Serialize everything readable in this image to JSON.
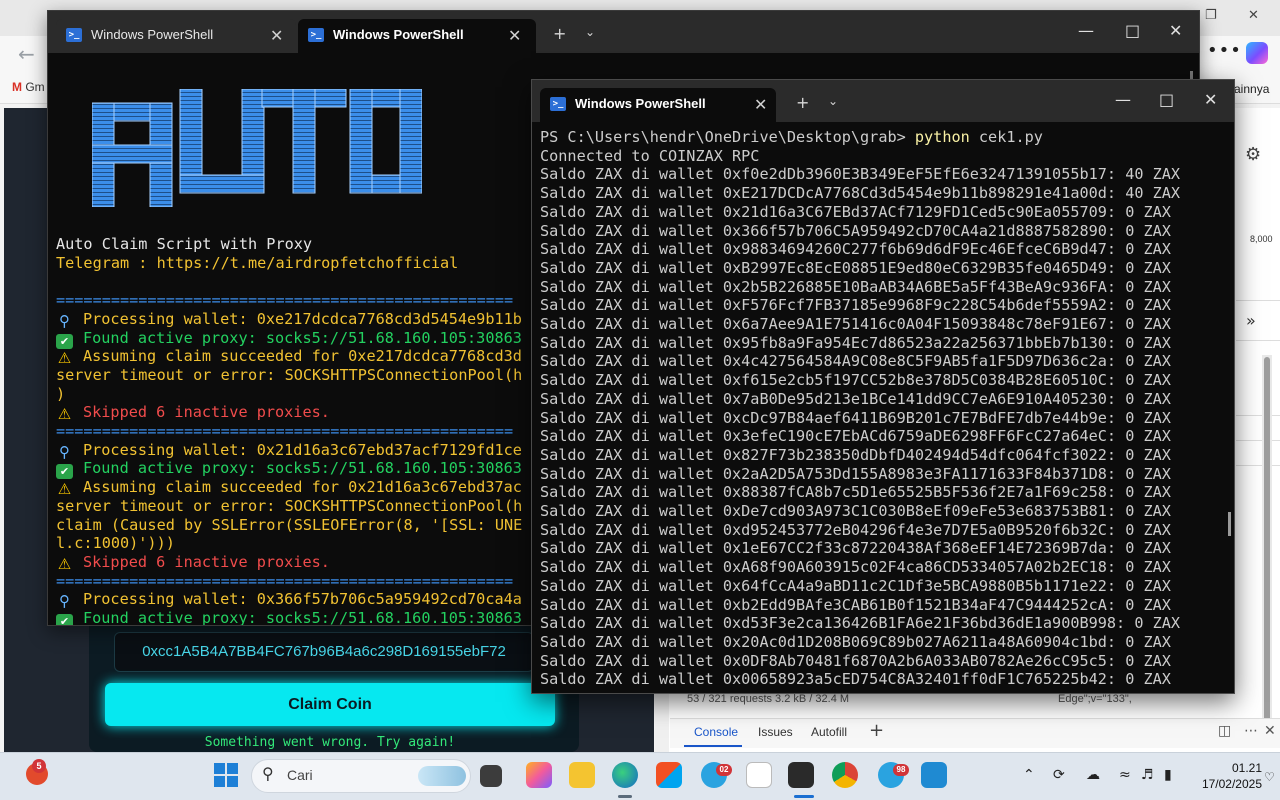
{
  "browser": {
    "bookmark_left": "Gm",
    "bookmark_right": "ainnya"
  },
  "dapp": {
    "wallet_address": "0xcc1A5B4A7BB4FC767b96B4a6c298D169155ebF72",
    "claim_button": "Claim Coin",
    "error_message": "Something went wrong. Try again!"
  },
  "devtools": {
    "status_left": "53 / 321 requests   3.2 kB / 32.4 M",
    "status_right": "Edge\";v=\"133\",",
    "tabs": [
      "Console",
      "Issues",
      "Autofill"
    ],
    "number_label": "8,000"
  },
  "window1": {
    "tabs": [
      {
        "label": "Windows PowerShell",
        "active": false
      },
      {
        "label": "Windows PowerShell",
        "active": true
      }
    ],
    "ascii_logo_text": "AUTO",
    "lines": [
      {
        "text": "Auto Claim Script with Proxy",
        "color": "white",
        "icon": ""
      },
      {
        "text": "Telegram : https://t.me/airdropfetchofficial",
        "color": "yellow",
        "icon": ""
      },
      {
        "text": "",
        "color": "white",
        "icon": ""
      },
      {
        "text": "==================================================",
        "color": "cyan",
        "icon": ""
      },
      {
        "text": "Processing wallet: 0xe217dcdca7768cd3d5454e9b11b",
        "color": "yellow",
        "icon": "magnifier"
      },
      {
        "text": "Found active proxy: socks5://51.68.160.105:30863",
        "color": "green",
        "icon": "check"
      },
      {
        "text": "Assuming claim succeeded for 0xe217dcdca7768cd3d",
        "color": "yellow",
        "icon": "warning"
      },
      {
        "text": "server timeout or error: SOCKSHTTPSConnectionPool(h",
        "color": "yellow",
        "icon": ""
      },
      {
        "text": ")",
        "color": "yellow",
        "icon": ""
      },
      {
        "text": "Skipped 6 inactive proxies.",
        "color": "red",
        "icon": "warning"
      },
      {
        "text": "==================================================",
        "color": "cyan",
        "icon": ""
      },
      {
        "text": "Processing wallet: 0x21d16a3c67ebd37acf7129fd1ce",
        "color": "yellow",
        "icon": "magnifier"
      },
      {
        "text": "Found active proxy: socks5://51.68.160.105:30863",
        "color": "green",
        "icon": "check"
      },
      {
        "text": "Assuming claim succeeded for 0x21d16a3c67ebd37ac",
        "color": "yellow",
        "icon": "warning"
      },
      {
        "text": "server timeout or error: SOCKSHTTPSConnectionPool(h",
        "color": "yellow",
        "icon": ""
      },
      {
        "text": "claim (Caused by SSLError(SSLEOFError(8, '[SSL: UNE",
        "color": "yellow",
        "icon": ""
      },
      {
        "text": "l.c:1000)')))",
        "color": "yellow",
        "icon": ""
      },
      {
        "text": "Skipped 6 inactive proxies.",
        "color": "red",
        "icon": "warning"
      },
      {
        "text": "==================================================",
        "color": "cyan",
        "icon": ""
      },
      {
        "text": "Processing wallet: 0x366f57b706c5a959492cd70ca4a",
        "color": "yellow",
        "icon": "magnifier"
      },
      {
        "text": "Found active proxy: socks5://51.68.160.105:30863",
        "color": "green",
        "icon": "check"
      }
    ]
  },
  "window2": {
    "tab_label": "Windows PowerShell",
    "prompt": "PS C:\\Users\\hendr\\OneDrive\\Desktop\\grab> ",
    "command": "python",
    "command_arg": " cek1.py",
    "lines": [
      "Connected to COINZAX RPC",
      "Saldo ZAX di wallet 0xf0e2dDb3960E3B349EeF5EfE6e32471391055b17: 40 ZAX",
      "Saldo ZAX di wallet 0xE217DCDcA7768Cd3d5454e9b11b898291e41a00d: 40 ZAX",
      "Saldo ZAX di wallet 0x21d16a3C67EBd37ACf7129FD1Ced5c90Ea055709: 0 ZAX",
      "Saldo ZAX di wallet 0x366f57b706C5A959492cD70CA4a21d8887582890: 0 ZAX",
      "Saldo ZAX di wallet 0x98834694260C277f6b69d6dF9Ec46EfceC6B9d47: 0 ZAX",
      "Saldo ZAX di wallet 0xB2997Ec8EcE08851E9ed80eC6329B35fe0465D49: 0 ZAX",
      "Saldo ZAX di wallet 0x2b5B226885E10BaAB34A6BE5a5Ff43BeA9c936FA: 0 ZAX",
      "Saldo ZAX di wallet 0xF576Fcf7FB37185e9968F9c228C54b6def5559A2: 0 ZAX",
      "Saldo ZAX di wallet 0x6a7Aee9A1E751416c0A04F15093848c78eF91E67: 0 ZAX",
      "Saldo ZAX di wallet 0x95fb8a9Fa954Ec7d86523a22a256371bbEb7b130: 0 ZAX",
      "Saldo ZAX di wallet 0x4c427564584A9C08e8C5F9AB5fa1F5D97D636c2a: 0 ZAX",
      "Saldo ZAX di wallet 0xf615e2cb5f197CC52b8e378D5C0384B28E60510C: 0 ZAX",
      "Saldo ZAX di wallet 0x7aB0De95d213e1BCe141dd9CC7eA6E910A405230: 0 ZAX",
      "Saldo ZAX di wallet 0xcDc97B84aef6411B69B201c7E7BdFE7db7e44b9e: 0 ZAX",
      "Saldo ZAX di wallet 0x3efeC190cE7EbACd6759aDE6298FF6FcC27a64eC: 0 ZAX",
      "Saldo ZAX di wallet 0x827F73b238350dDbfD402494d54dfc064fcf3022: 0 ZAX",
      "Saldo ZAX di wallet 0x2aA2D5A753Dd155A8983e3FA1171633F84b371D8: 0 ZAX",
      "Saldo ZAX di wallet 0x88387fCA8b7c5D1e65525B5F536f2E7a1F69c258: 0 ZAX",
      "Saldo ZAX di wallet 0xDe7cd903A973C1C030B8eEf09eFe53e683753B81: 0 ZAX",
      "Saldo ZAX di wallet 0xd952453772eB04296f4e3e7D7E5a0B9520f6b32C: 0 ZAX",
      "Saldo ZAX di wallet 0x1eE67CC2f33c87220438Af368eEF14E72369B7da: 0 ZAX",
      "Saldo ZAX di wallet 0xA68f90A603915c02F4ca86CD5334057A02b2EC18: 0 ZAX",
      "Saldo ZAX di wallet 0x64fCcA4a9aBD11c2C1Df3e5BCA9880B5b1171e22: 0 ZAX",
      "Saldo ZAX di wallet 0xb2Edd9BAfe3CAB61B0f1521B34aF47C9444252cA: 0 ZAX",
      "Saldo ZAX di wallet 0xd53F3e2ca136426B1FA6e21F36bd36dE1a900B998: 0 ZAX",
      "Saldo ZAX di wallet 0x20Ac0d1D208B069C89b027A6211a48A60904c1bd: 0 ZAX",
      "Saldo ZAX di wallet 0x0DF8Ab70481f6870A2b6A033AB0782Ae26cC95c5: 0 ZAX",
      "Saldo ZAX di wallet 0x00658923a5cED754C8A32401ff0dF1C765225b42: 0 ZAX"
    ]
  },
  "taskbar": {
    "search_placeholder": "Cari",
    "time": "01.21",
    "date": "17/02/2025",
    "badges": {
      "notifications": "5",
      "telegram_1": "02",
      "telegram_2": "98"
    }
  },
  "colors": {
    "terminal_bg": "#0c0c0c",
    "titlebar_bg": "#2b2b2b",
    "ascii_blue": "#3b8eea",
    "claim_cyan": "#06e8f0"
  }
}
